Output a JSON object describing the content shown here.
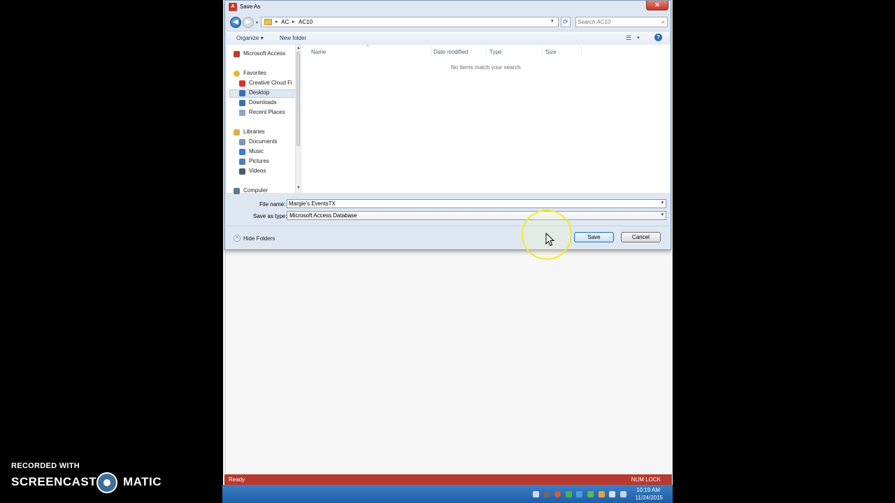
{
  "dialog": {
    "title": "Save As",
    "app_icon_text": "A",
    "close_glyph": "✕"
  },
  "address": {
    "crumbs": [
      "AC",
      "AC10"
    ],
    "separator": "▸",
    "dropdown_glyph": "▾",
    "refresh_glyph": "⟳"
  },
  "search": {
    "placeholder": "Search AC10",
    "icon": "search-icon"
  },
  "toolbar": {
    "organize": "Organize ▾",
    "new_folder": "New folder",
    "views_glyph": "☰",
    "views_drop": "▾",
    "help": "?"
  },
  "nav": {
    "items": [
      {
        "label": "Microsoft Access",
        "icon": "access-icon",
        "color": "#c0392b"
      },
      {
        "label": "Favorites",
        "icon": "star-icon",
        "color": "#e5b82a"
      },
      {
        "label": "Creative Cloud Fi",
        "icon": "creative-cloud-icon",
        "color": "#d9342b"
      },
      {
        "label": "Desktop",
        "icon": "desktop-icon",
        "color": "#3a6fb5"
      },
      {
        "label": "Downloads",
        "icon": "downloads-icon",
        "color": "#3a6fb5"
      },
      {
        "label": "Recent Places",
        "icon": "recent-places-icon",
        "color": "#8ea4bf"
      },
      {
        "label": "Libraries",
        "icon": "libraries-icon",
        "color": "#d8b44a"
      },
      {
        "label": "Documents",
        "icon": "documents-icon",
        "color": "#7f95b3"
      },
      {
        "label": "Music",
        "icon": "music-icon",
        "color": "#3b7bd1"
      },
      {
        "label": "Pictures",
        "icon": "pictures-icon",
        "color": "#4f7fb8"
      },
      {
        "label": "Videos",
        "icon": "videos-icon",
        "color": "#4a5b70"
      },
      {
        "label": "Computer",
        "icon": "computer-icon",
        "color": "#5c7896"
      }
    ]
  },
  "columns": [
    "Name",
    "Date modified",
    "Type",
    "Size"
  ],
  "empty_message": "No items match your search.",
  "form": {
    "file_name_label": "File name:",
    "file_name_value": "Margie's EventsTX",
    "save_type_label": "Save as type:",
    "save_type_value": "Microsoft Access Database",
    "dropdown_glyph": "▾"
  },
  "footer": {
    "hide_folders": "Hide Folders",
    "save": "Save",
    "cancel": "Cancel"
  },
  "statusbar": {
    "left": "Ready",
    "right": "NUM LOCK",
    "color": "#b7392f"
  },
  "clock": {
    "time": "10:19 AM",
    "date": "11/24/2015"
  },
  "watermark": {
    "line1": "RECORDED WITH",
    "line2a": "SCREENCAST",
    "line2b": "MATIC"
  }
}
